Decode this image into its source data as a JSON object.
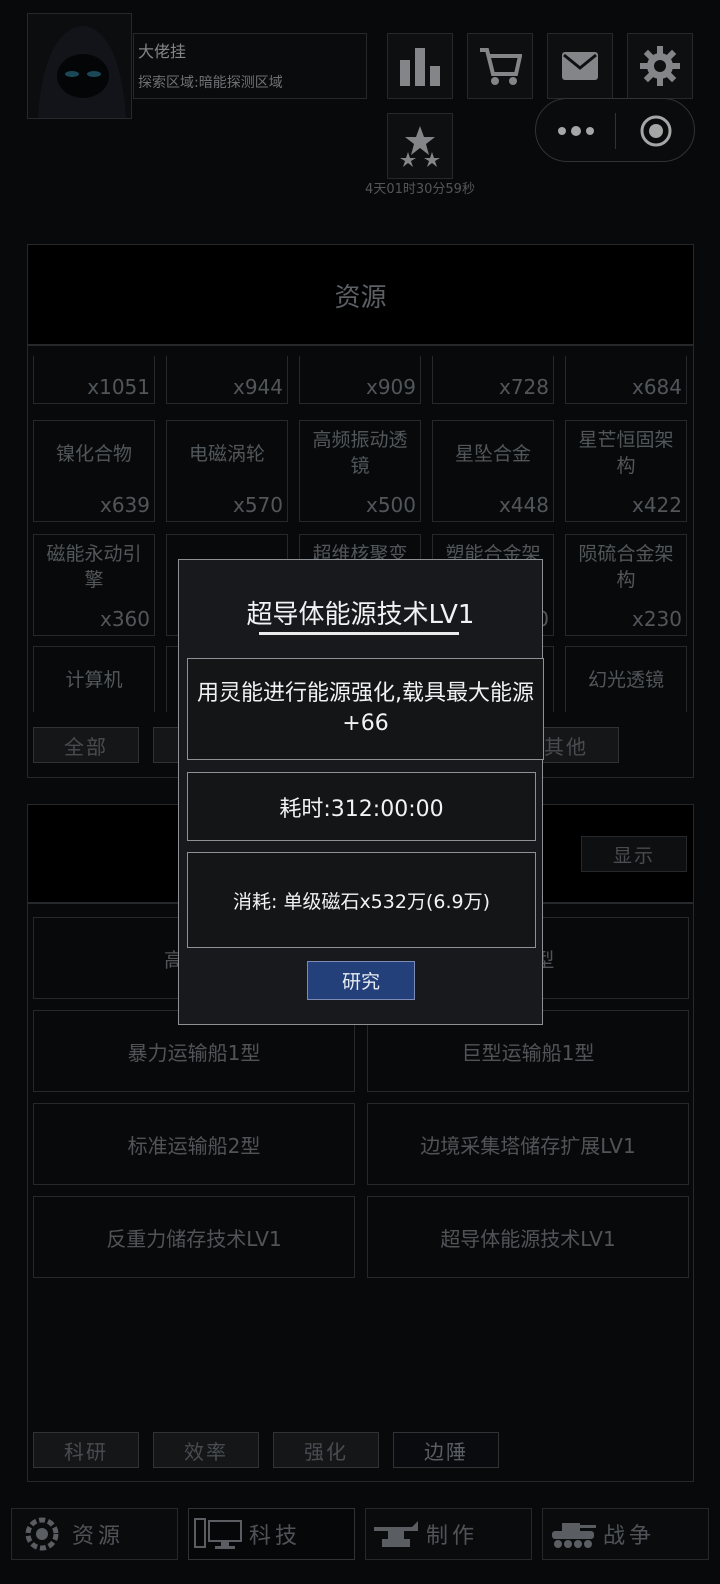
{
  "header": {
    "player_name": "大佬挂",
    "explore_area": "探索区域:暗能探测区域",
    "timer": "4天01时30分59秒",
    "icons": [
      "stats-icon",
      "cart-icon",
      "mail-icon",
      "gear-icon",
      "rank-stars-icon"
    ]
  },
  "resources": {
    "title": "资源",
    "top_counts": [
      "x1051",
      "x944",
      "x909",
      "x728",
      "x684"
    ],
    "row2": [
      {
        "name": "镍化合物",
        "count": "x639"
      },
      {
        "name": "电磁涡轮",
        "count": "x570"
      },
      {
        "name": "高频振动透镜",
        "count": "x500"
      },
      {
        "name": "星坠合金",
        "count": "x448"
      },
      {
        "name": "星芒恒固架构",
        "count": "x422"
      }
    ],
    "row3": [
      {
        "name": "磁能永动引擎",
        "count": "x360"
      },
      {
        "name": "",
        "count": ""
      },
      {
        "name": "超维核聚变",
        "count": ""
      },
      {
        "name": "塑能合金架",
        "count": "0"
      },
      {
        "name": "陨硫合金架构",
        "count": "x230"
      }
    ],
    "row4": [
      {
        "name": "计算机",
        "count": ""
      },
      {
        "name": "",
        "count": ""
      },
      {
        "name": "",
        "count": ""
      },
      {
        "name": "",
        "count": ""
      },
      {
        "name": "幻光透镜",
        "count": ""
      }
    ],
    "filters": [
      "全部",
      "其他"
    ]
  },
  "tech": {
    "show_label": "显示",
    "items": [
      "高速运",
      "船1型",
      "暴力运输船1型",
      "巨型运输船1型",
      "标准运输船2型",
      "边境采集塔储存扩展LV1",
      "反重力储存技术LV1",
      "超导体能源技术LV1"
    ],
    "tabs": [
      "科研",
      "效率",
      "强化",
      "边陲"
    ]
  },
  "nav": [
    {
      "label": "资源",
      "icon": "gear-wheel-icon"
    },
    {
      "label": "科技",
      "icon": "computer-icon"
    },
    {
      "label": "制作",
      "icon": "anvil-icon"
    },
    {
      "label": "战争",
      "icon": "tank-icon"
    }
  ],
  "modal": {
    "title": "超导体能源技术LV1",
    "description": "用灵能进行能源强化,载具最大能源+66",
    "time": "耗时:312:00:00",
    "cost": "消耗: 单级磁石x532万(6.9万)",
    "button": "研究"
  }
}
